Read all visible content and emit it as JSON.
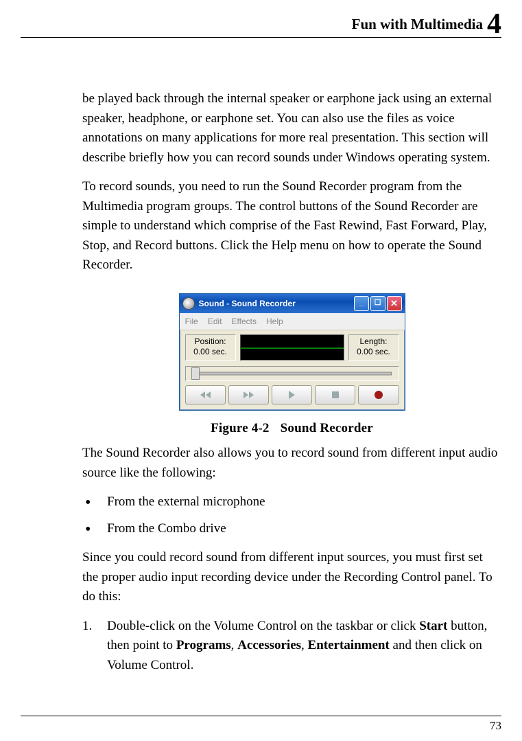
{
  "header": {
    "title": "Fun with Multimedia",
    "chapter": "4"
  },
  "paras": {
    "p1": "be played back through the internal speaker or earphone jack using an external speaker, headphone, or earphone set. You can also use the files as voice annotations on many applications for more real presentation. This section will describe briefly how you can record sounds under Windows operating system.",
    "p2": "To record sounds, you need to run the Sound Recorder program from the Multimedia program groups. The control buttons of the Sound Recorder are simple to understand which comprise of the Fast Rewind, Fast Forward, Play, Stop, and Record buttons. Click the Help menu on how to operate the Sound Recorder.",
    "p3": "The Sound Recorder also allows you to record sound from different input audio source like the following:",
    "p4": "Since you could record sound from different input sources, you must first set the proper audio input recording device under the Recording Control panel. To do this:"
  },
  "bullets": [
    "From the external microphone",
    "From the Combo drive"
  ],
  "step1": {
    "pre1": "Double-click on the Volume Control on the taskbar or click ",
    "b1": "Start",
    "mid1": " button, then point to ",
    "b2": "Programs",
    "c1": ", ",
    "b3": "Accessories",
    "c2": ", ",
    "b4": "Entertainment",
    "mid2": " and then click on Volume Control."
  },
  "figure": {
    "num_label": "Figure 4-2",
    "title": "Sound Recorder"
  },
  "recorder": {
    "window_title": "Sound - Sound Recorder",
    "menu": {
      "file": "File",
      "edit": "Edit",
      "effects": "Effects",
      "help": "Help"
    },
    "pos_label": "Position:",
    "pos_value": "0.00 sec.",
    "len_label": "Length:",
    "len_value": "0.00 sec."
  },
  "page_number": "73"
}
